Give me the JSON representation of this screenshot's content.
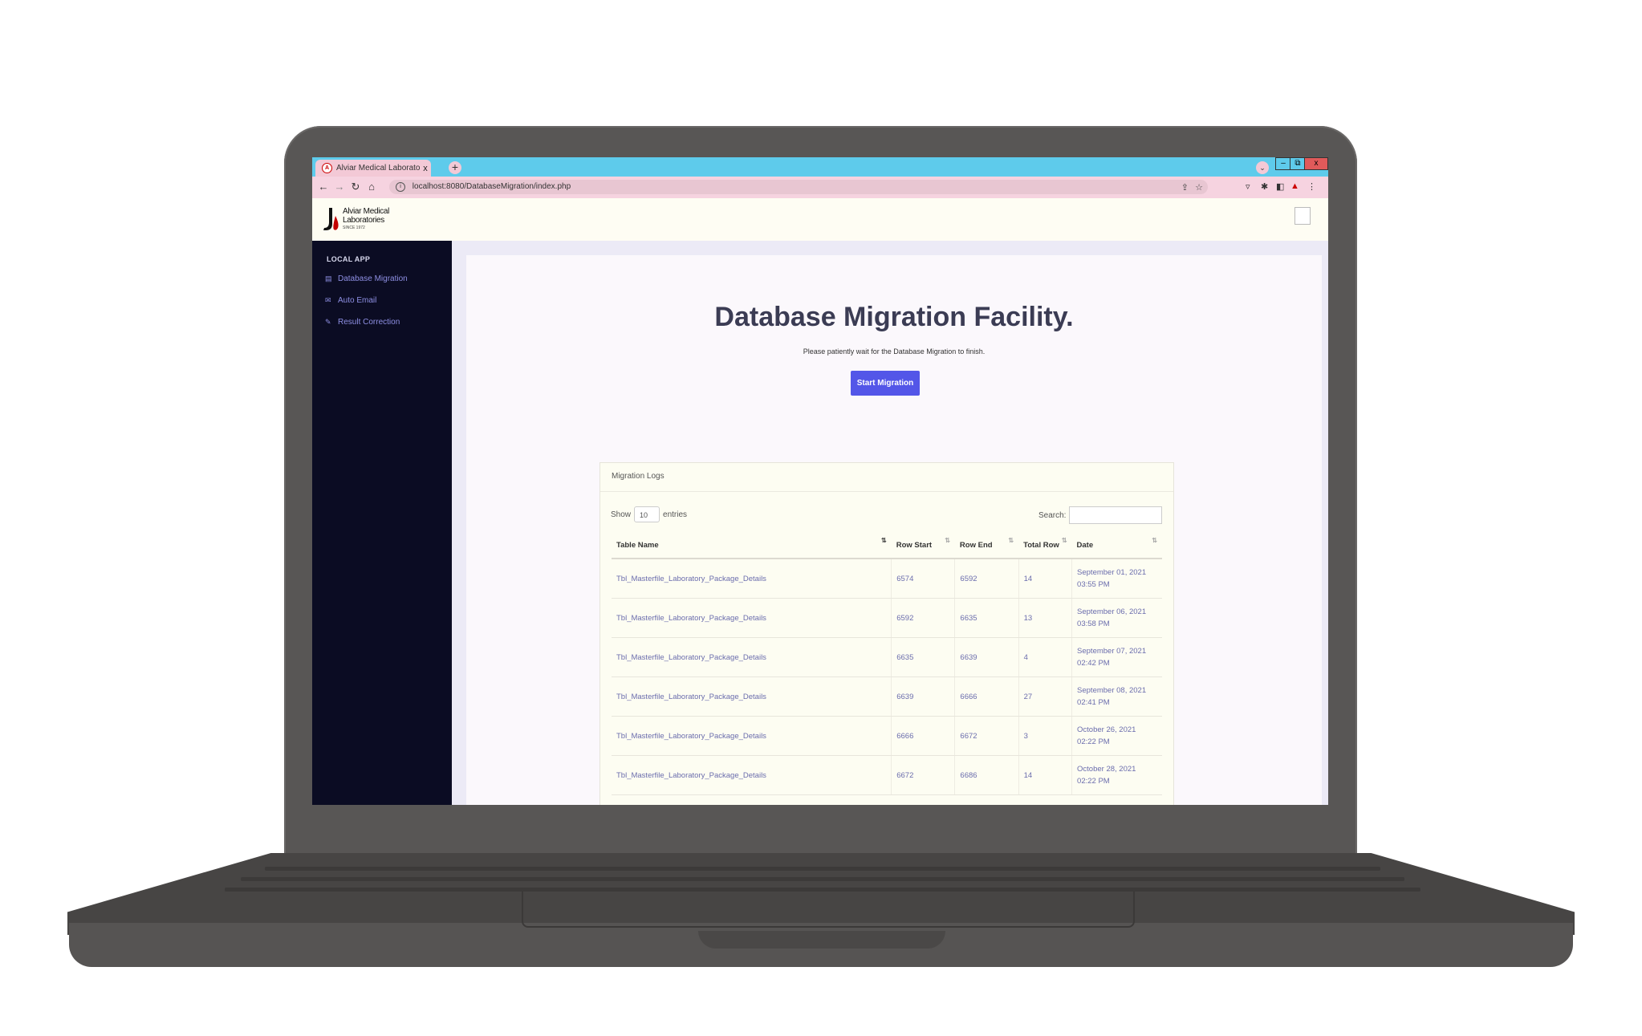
{
  "browser": {
    "tab_title": "Alviar Medical Laboratories",
    "tab_close": "x",
    "new_tab": "+",
    "url": "localhost:8080/DatabaseMigration/index.php",
    "window_buttons": {
      "minimize": "–",
      "restore": "⧉",
      "close": "x"
    }
  },
  "app": {
    "logo": {
      "name_line1": "Alviar Medical",
      "name_line2": "Laboratories",
      "since": "SINCE 1972"
    }
  },
  "sidebar": {
    "section": "LOCAL APP",
    "items": [
      {
        "label": "Database Migration",
        "icon": "database-icon"
      },
      {
        "label": "Auto Email",
        "icon": "envelope-icon"
      },
      {
        "label": "Result Correction",
        "icon": "edit-icon"
      }
    ]
  },
  "main": {
    "title": "Database Migration Facility.",
    "subtitle": "Please patiently wait for the Database Migration to finish.",
    "start_button": "Start Migration"
  },
  "logs": {
    "card_title": "Migration Logs",
    "show_label": "Show",
    "entries_value": "10",
    "entries_label": "entries",
    "search_label": "Search:",
    "columns": [
      "Table Name",
      "Row Start",
      "Row End",
      "Total Row",
      "Date"
    ],
    "rows": [
      {
        "table": "Tbl_Masterfile_Laboratory_Package_Details",
        "start": "6574",
        "end": "6592",
        "total": "14",
        "date1": "September 01, 2021",
        "date2": "03:55 PM"
      },
      {
        "table": "Tbl_Masterfile_Laboratory_Package_Details",
        "start": "6592",
        "end": "6635",
        "total": "13",
        "date1": "September 06, 2021",
        "date2": "03:58 PM"
      },
      {
        "table": "Tbl_Masterfile_Laboratory_Package_Details",
        "start": "6635",
        "end": "6639",
        "total": "4",
        "date1": "September 07, 2021",
        "date2": "02:42 PM"
      },
      {
        "table": "Tbl_Masterfile_Laboratory_Package_Details",
        "start": "6639",
        "end": "6666",
        "total": "27",
        "date1": "September 08, 2021",
        "date2": "02:41 PM"
      },
      {
        "table": "Tbl_Masterfile_Laboratory_Package_Details",
        "start": "6666",
        "end": "6672",
        "total": "3",
        "date1": "October 26, 2021",
        "date2": "02:22 PM"
      },
      {
        "table": "Tbl_Masterfile_Laboratory_Package_Details",
        "start": "6672",
        "end": "6686",
        "total": "14",
        "date1": "October 28, 2021",
        "date2": "02:22 PM"
      }
    ]
  },
  "colors": {
    "sidebar_bg": "#0b0c23",
    "accent": "#5356e8",
    "tabbar": "#5ecbeb",
    "addressbar": "#f6d3e0",
    "laptop": "#585655"
  }
}
